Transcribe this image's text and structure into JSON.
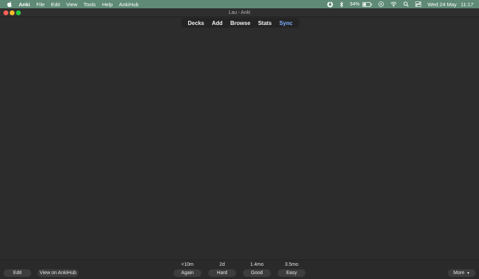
{
  "menubar": {
    "app_name": "Anki",
    "menus": [
      "File",
      "Edit",
      "View",
      "Tools",
      "Help",
      "AnkiHub"
    ],
    "battery_percent": "34%",
    "date": "Wed 24 May",
    "time": "11:17",
    "background": "#5e8a76"
  },
  "window": {
    "title": "Lau - Anki"
  },
  "toolbar": {
    "decks": "Decks",
    "add": "Add",
    "browse": "Browse",
    "stats": "Stats",
    "sync": "Sync",
    "sync_color": "#7fb0ff"
  },
  "review": {
    "edit": "Edit",
    "view_on_ankihub": "View on AnkiHub",
    "more": "More",
    "answers": [
      {
        "interval": "<10m",
        "label": "Again"
      },
      {
        "interval": "2d",
        "label": "Hard"
      },
      {
        "interval": "1.4mo",
        "label": "Good"
      },
      {
        "interval": "3.5mo",
        "label": "Easy"
      }
    ]
  }
}
